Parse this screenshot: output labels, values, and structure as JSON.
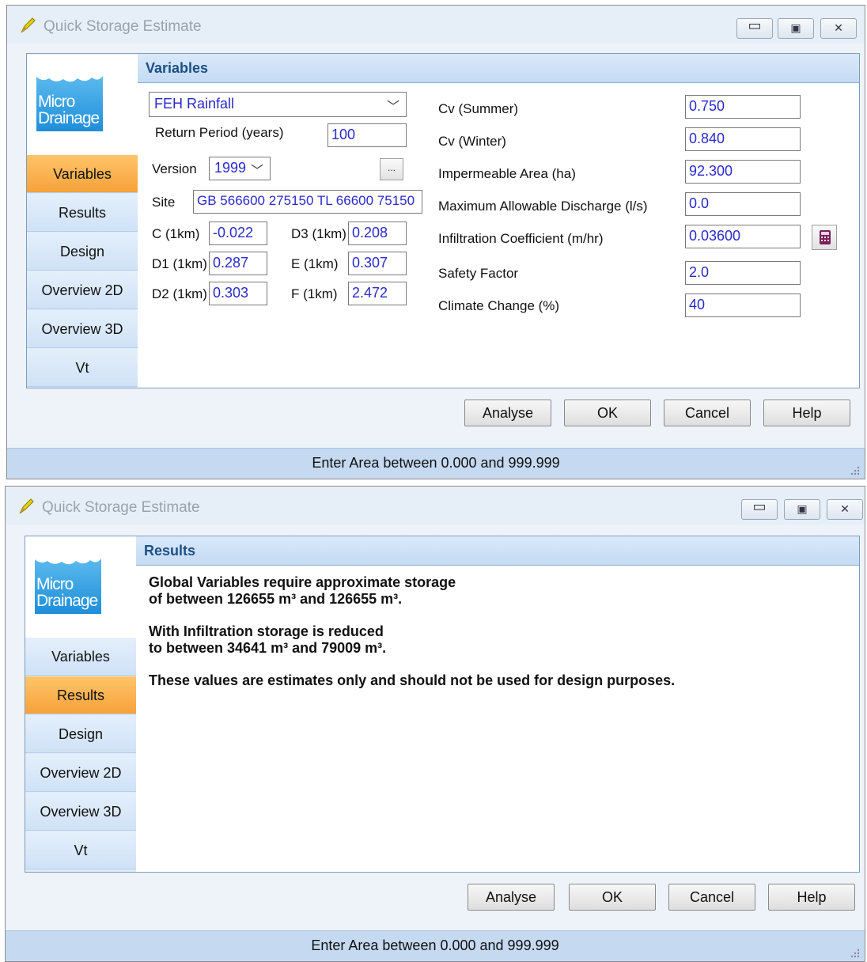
{
  "window1": {
    "title": "Quick Storage Estimate",
    "panel_title": "Variables",
    "rainfall_select": "FEH Rainfall",
    "return_period_label": "Return Period (years)",
    "return_period_value": "100",
    "version_label": "Version",
    "version_value": "1999",
    "dots_label": "...",
    "site_label": "Site",
    "site_value": "GB 566600 275150 TL 66600 75150",
    "c_label": "C (1km)",
    "c_value": "-0.022",
    "d1_label": "D1 (1km)",
    "d1_value": "0.287",
    "d2_label": "D2 (1km)",
    "d2_value": "0.303",
    "d3_label": "D3 (1km)",
    "d3_value": "0.208",
    "e_label": "E (1km)",
    "e_value": "0.307",
    "f_label": "F (1km)",
    "f_value": "2.472",
    "cv_summer_label": "Cv (Summer)",
    "cv_summer_value": "0.750",
    "cv_winter_label": "Cv (Winter)",
    "cv_winter_value": "0.840",
    "imp_area_label": "Impermeable Area (ha)",
    "imp_area_value": "92.300",
    "max_discharge_label": "Maximum Allowable Discharge (l/s)",
    "max_discharge_value": "0.0",
    "infil_label": "Infiltration Coefficient (m/hr)",
    "infil_value": "0.03600",
    "safety_label": "Safety Factor",
    "safety_value": "2.0",
    "climate_label": "Climate Change (%)",
    "climate_value": "40",
    "status": "Enter Area between 0.000 and 999.999"
  },
  "window2": {
    "title": "Quick Storage Estimate",
    "panel_title": "Results",
    "line1": "Global Variables require approximate storage",
    "line2": "of between 126655 m³ and 126655 m³.",
    "line3": "With Infiltration storage is reduced",
    "line4": "to between 34641 m³ and 79009 m³.",
    "line5": "These values are estimates only and should not be used for design purposes.",
    "status": "Enter Area between 0.000 and 999.999"
  },
  "logo": {
    "line1": "Micro",
    "line2": "Drainage"
  },
  "nav": {
    "variables": "Variables",
    "results": "Results",
    "design": "Design",
    "overview2d": "Overview 2D",
    "overview3d": "Overview 3D",
    "vt": "Vt"
  },
  "buttons": {
    "analyse": "Analyse",
    "ok": "OK",
    "cancel": "Cancel",
    "help": "Help"
  },
  "colors": {
    "active_tab": "#f6a23a",
    "panel_header": "#c4dbf3",
    "value_text": "#2a2acf"
  }
}
